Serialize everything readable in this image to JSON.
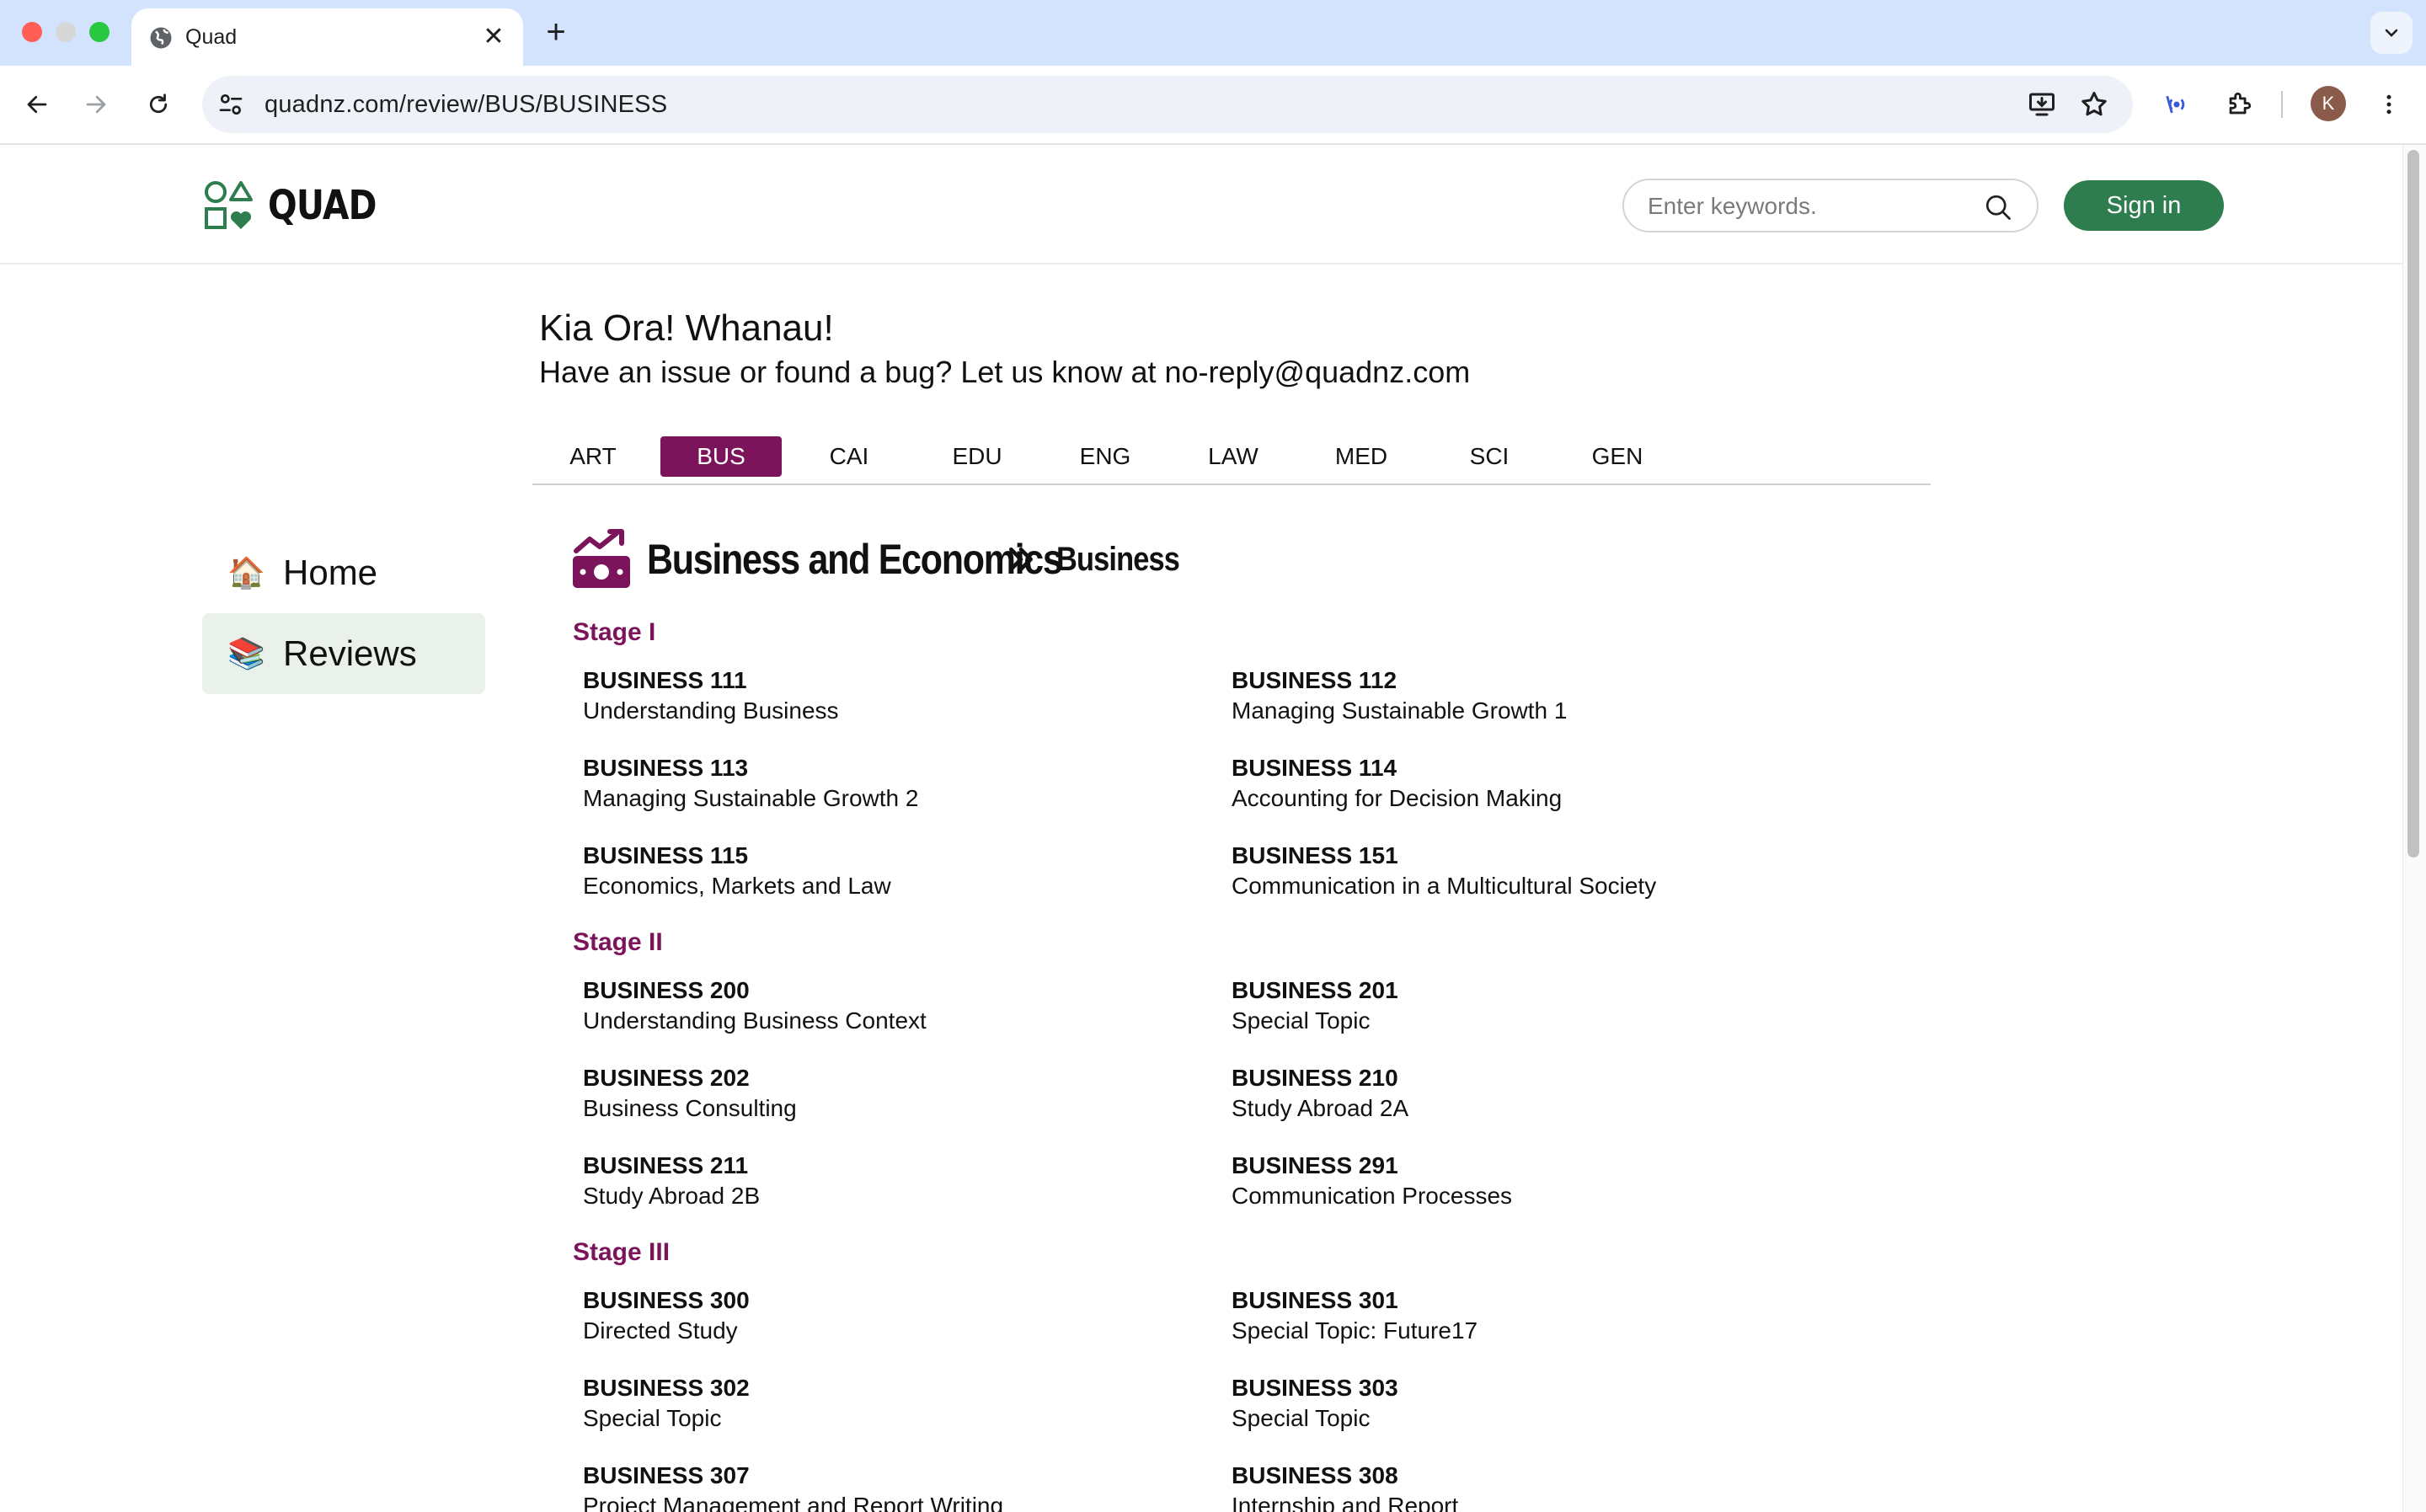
{
  "browser": {
    "tab_title": "Quad",
    "url": "quadnz.com/review/BUS/BUSINESS",
    "avatar_letter": "K"
  },
  "header": {
    "logo_text": "QUAD",
    "search_placeholder": "Enter keywords.",
    "signin_label": "Sign in",
    "brand_color": "#2e7d4f"
  },
  "sidebar": {
    "items": [
      {
        "label": "Home",
        "emoji": "🏠"
      },
      {
        "label": "Reviews",
        "emoji": "📚"
      }
    ]
  },
  "greeting": {
    "title": "Kia Ora! Whanau!",
    "subtitle": "Have an issue or found a bug? Let us know at no-reply@quadnz.com"
  },
  "faculty_tabs": {
    "items": [
      "ART",
      "BUS",
      "CAI",
      "EDU",
      "ENG",
      "LAW",
      "MED",
      "SCI",
      "GEN"
    ],
    "active": "BUS",
    "accent_color": "#7b145a"
  },
  "breadcrumb": {
    "faculty": "Business and Economics",
    "department": "Business"
  },
  "stages": [
    {
      "title": "Stage I",
      "courses": [
        {
          "code": "BUSINESS 111",
          "name": "Understanding Business"
        },
        {
          "code": "BUSINESS 112",
          "name": "Managing Sustainable Growth 1"
        },
        {
          "code": "BUSINESS 113",
          "name": "Managing Sustainable Growth 2"
        },
        {
          "code": "BUSINESS 114",
          "name": "Accounting for Decision Making"
        },
        {
          "code": "BUSINESS 115",
          "name": "Economics, Markets and Law"
        },
        {
          "code": "BUSINESS 151",
          "name": "Communication in a Multicultural Society"
        }
      ]
    },
    {
      "title": "Stage II",
      "courses": [
        {
          "code": "BUSINESS 200",
          "name": "Understanding Business Context"
        },
        {
          "code": "BUSINESS 201",
          "name": "Special Topic"
        },
        {
          "code": "BUSINESS 202",
          "name": "Business Consulting"
        },
        {
          "code": "BUSINESS 210",
          "name": "Study Abroad 2A"
        },
        {
          "code": "BUSINESS 211",
          "name": "Study Abroad 2B"
        },
        {
          "code": "BUSINESS 291",
          "name": "Communication Processes"
        }
      ]
    },
    {
      "title": "Stage III",
      "courses": [
        {
          "code": "BUSINESS 300",
          "name": "Directed Study"
        },
        {
          "code": "BUSINESS 301",
          "name": "Special Topic: Future17"
        },
        {
          "code": "BUSINESS 302",
          "name": "Special Topic"
        },
        {
          "code": "BUSINESS 303",
          "name": "Special Topic"
        },
        {
          "code": "BUSINESS 307",
          "name": "Project Management and Report Writing"
        },
        {
          "code": "BUSINESS 308",
          "name": "Internship and Report"
        }
      ]
    }
  ]
}
